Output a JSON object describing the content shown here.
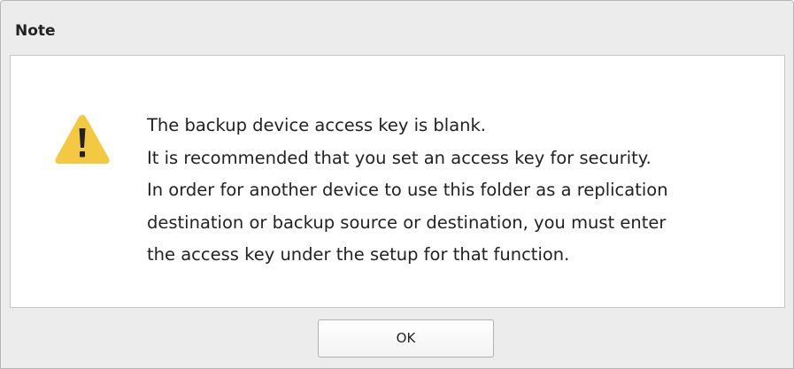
{
  "dialog": {
    "title": "Note",
    "icon": "warning-icon",
    "message_lines": [
      "The backup device access key is blank.",
      "It is recommended that you set an access key for security.",
      "In order for another device to use this folder as a replication",
      "destination or backup source or destination, you must enter",
      "the access key under the setup for that function."
    ],
    "ok_label": "OK"
  },
  "colors": {
    "warning_fill": "#f5c842",
    "warning_mark": "#222222",
    "dialog_bg": "#ececec",
    "content_bg": "#ffffff"
  }
}
